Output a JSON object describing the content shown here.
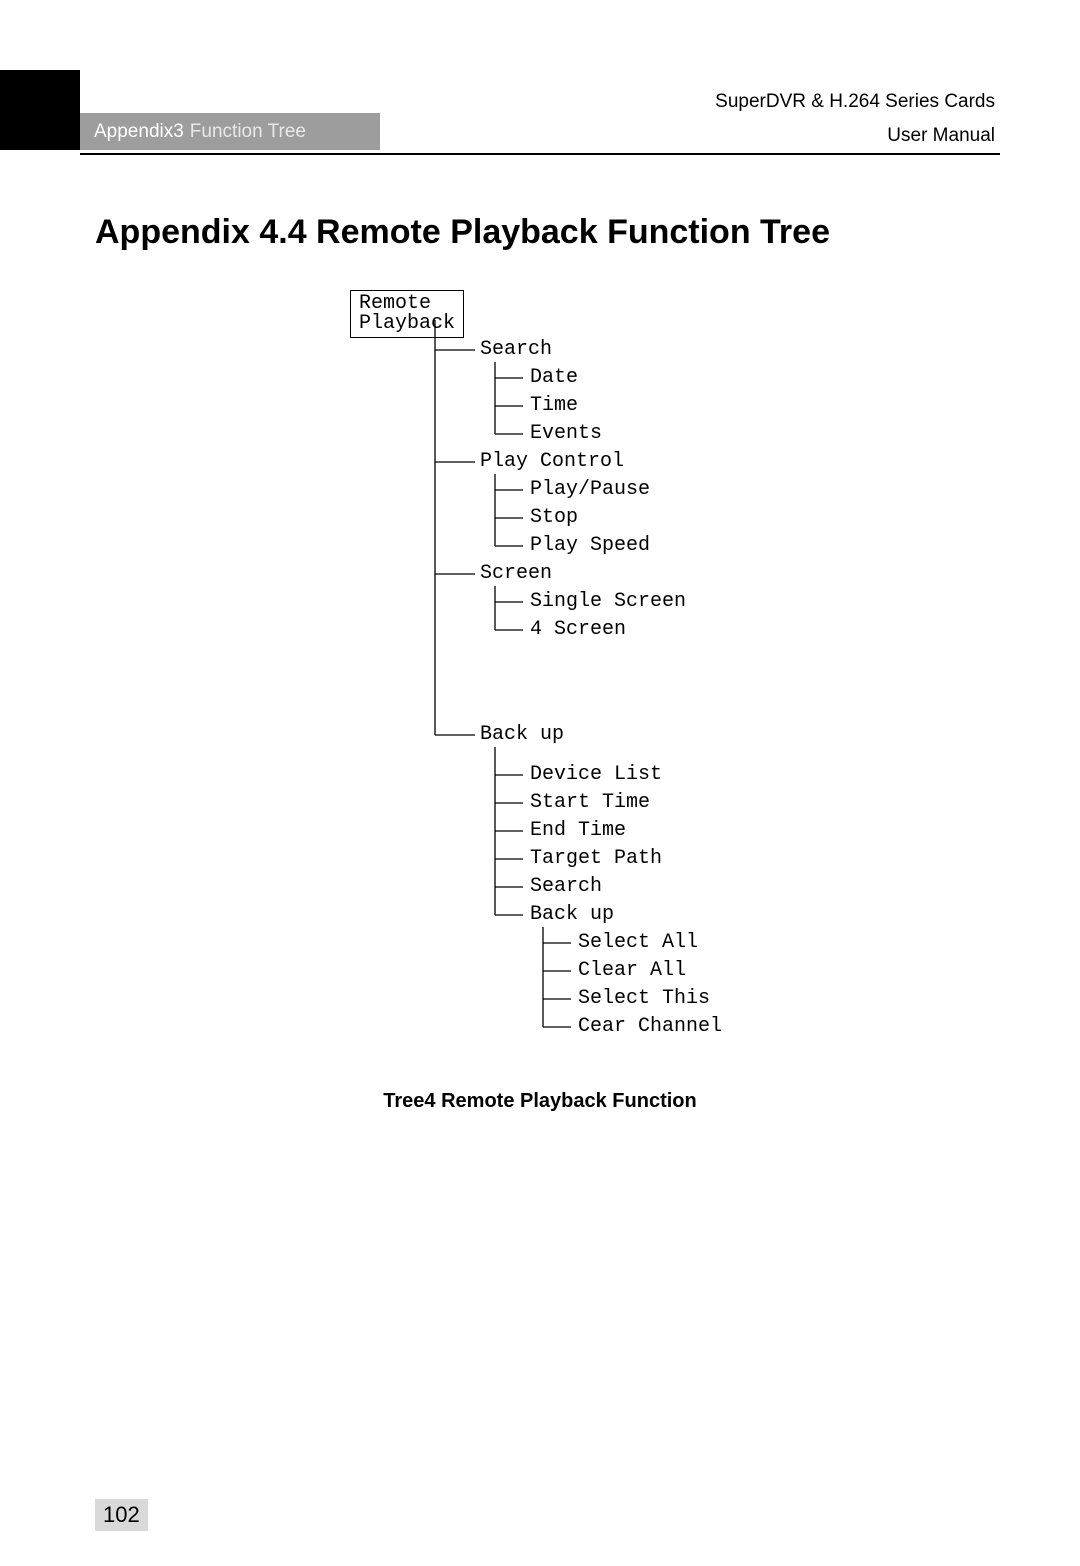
{
  "header": {
    "appendix_label": "Appendix3",
    "appendix_sub": "Function Tree",
    "product": "SuperDVR & H.264 Series Cards",
    "doc_type": "User  Manual"
  },
  "title": "Appendix 4.4 Remote Playback Function Tree",
  "tree": {
    "root": "Remote Playback",
    "search": "Search",
    "search_date": "Date",
    "search_time": "Time",
    "search_events": "Events",
    "play_control": "Play Control",
    "pc_play_pause": "Play/Pause",
    "pc_stop": "Stop",
    "pc_play_speed": "Play Speed",
    "screen": "Screen",
    "sc_single": "Single Screen",
    "sc_four": "4 Screen",
    "backup": "Back up",
    "bu_device_list": "Device List",
    "bu_start_time": "Start Time",
    "bu_end_time": "End Time",
    "bu_target_path": "Target Path",
    "bu_search": "Search",
    "bu_backup": "Back up",
    "bu_bu_select_all": "Select All",
    "bu_bu_clear_all": "Clear All",
    "bu_bu_select_this": "Select This",
    "bu_bu_clear_channel": "Cear Channel"
  },
  "caption": "Tree4 Remote Playback Function",
  "page_number": "102",
  "chart_data": {
    "type": "tree",
    "title": "Remote Playback Function Tree",
    "root": "Remote Playback",
    "children": [
      {
        "name": "Search",
        "children": [
          {
            "name": "Date"
          },
          {
            "name": "Time"
          },
          {
            "name": "Events"
          }
        ]
      },
      {
        "name": "Play Control",
        "children": [
          {
            "name": "Play/Pause"
          },
          {
            "name": "Stop"
          },
          {
            "name": "Play Speed"
          }
        ]
      },
      {
        "name": "Screen",
        "children": [
          {
            "name": "Single Screen"
          },
          {
            "name": "4 Screen"
          }
        ]
      },
      {
        "name": "Back up",
        "children": [
          {
            "name": "Device List"
          },
          {
            "name": "Start Time"
          },
          {
            "name": "End Time"
          },
          {
            "name": "Target Path"
          },
          {
            "name": "Search"
          },
          {
            "name": "Back up",
            "children": [
              {
                "name": "Select All"
              },
              {
                "name": "Clear All"
              },
              {
                "name": "Select This"
              },
              {
                "name": "Cear Channel"
              }
            ]
          }
        ]
      }
    ]
  }
}
